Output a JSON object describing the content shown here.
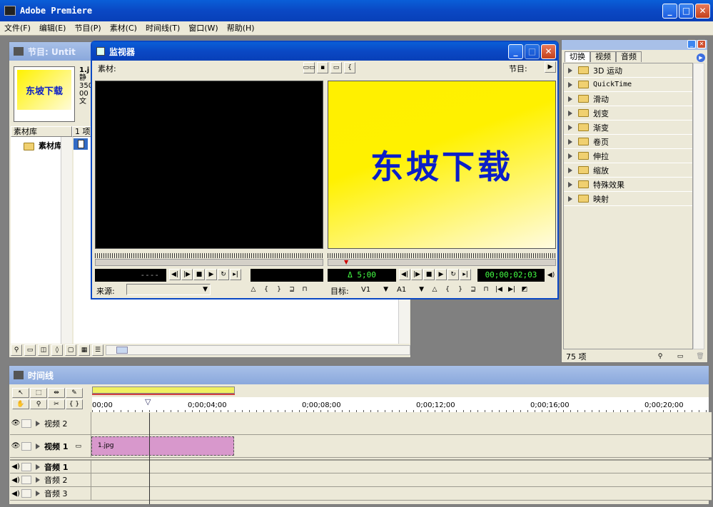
{
  "app": {
    "title": "Adobe Premiere"
  },
  "menu": [
    "文件(F)",
    "编辑(E)",
    "节目(P)",
    "素材(C)",
    "时间线(T)",
    "窗口(W)",
    "帮助(H)"
  ],
  "project": {
    "title": "节目: Untit",
    "thumb_text": "东坡下载",
    "info_lines": [
      "1.j",
      "静",
      "350",
      "00",
      "文"
    ],
    "col_bin": "素材库",
    "col_items": "1 项",
    "bin_item": "素材库"
  },
  "monitor": {
    "title": "监视器",
    "source_label": "素材:",
    "program_label": "节目:",
    "program_text": "东坡下载",
    "source_timecode": "----",
    "duration": "Δ 5;00",
    "program_timecode": "00;00;02;03",
    "source_dropdown_label": "来源:",
    "target_label": "目标:",
    "target_v": "V1",
    "target_a": "A1"
  },
  "transitions": {
    "tabs": [
      "切换",
      "视频",
      "音频"
    ],
    "items": [
      "3D 运动",
      "QuickTime",
      "滑动",
      "划变",
      "渐变",
      "卷页",
      "伸拉",
      "缩放",
      "特殊效果",
      "映射"
    ],
    "count": "75 项"
  },
  "timeline": {
    "title": "时间线",
    "ruler_labels": [
      "00;00",
      "0;00;04;00",
      "0;00;08;00",
      "0;00;12;00",
      "0;00;16;00",
      "0;00;20;00"
    ],
    "tracks": [
      {
        "name": "视频 2",
        "bold": false
      },
      {
        "name": "视频 1",
        "bold": true
      },
      {
        "name": "音频 1",
        "bold": true
      },
      {
        "name": "音频 2",
        "bold": false
      },
      {
        "name": "音频 3",
        "bold": false
      }
    ],
    "clip_label": "1.jpg"
  },
  "colors": {
    "titlebar": "#0a48c4",
    "clip": "#d898cc",
    "yellow": "#fff200",
    "text_blue": "#0a1ec8"
  }
}
